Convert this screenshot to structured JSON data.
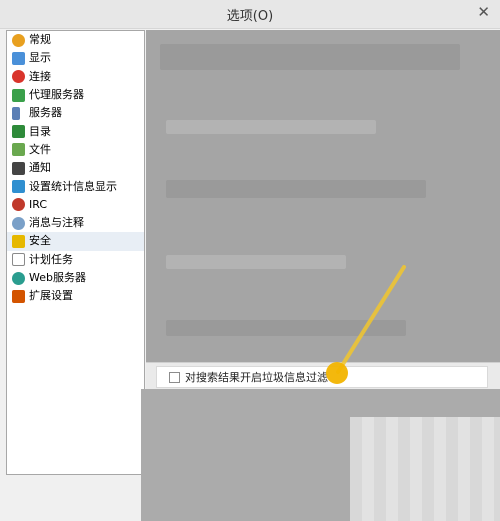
{
  "window": {
    "title": "选项(O)"
  },
  "sidebar": {
    "items": [
      {
        "label": "常规",
        "icon": "gear-icon",
        "color": "#e8a020"
      },
      {
        "label": "显示",
        "icon": "display-icon",
        "color": "#4a90d9"
      },
      {
        "label": "连接",
        "icon": "connection-icon",
        "color": "#d9342b"
      },
      {
        "label": "代理服务器",
        "icon": "proxy-icon",
        "color": "#3aa04a"
      },
      {
        "label": "服务器",
        "icon": "server-icon",
        "color": "#5b7fb5"
      },
      {
        "label": "目录",
        "icon": "folder-icon",
        "color": "#2e8b3a"
      },
      {
        "label": "文件",
        "icon": "file-icon",
        "color": "#6aa84f"
      },
      {
        "label": "通知",
        "icon": "notification-icon",
        "color": "#444444"
      },
      {
        "label": "设置统计信息显示",
        "icon": "statistics-icon",
        "color": "#2f8fd0"
      },
      {
        "label": "IRC",
        "icon": "irc-icon",
        "color": "#c0392b"
      },
      {
        "label": "消息与注释",
        "icon": "message-icon",
        "color": "#7aa0c8"
      },
      {
        "label": "安全",
        "icon": "lock-icon",
        "color": "#e6b800"
      },
      {
        "label": "计划任务",
        "icon": "schedule-icon",
        "color": "#8a8a8a"
      },
      {
        "label": "Web服务器",
        "icon": "web-icon",
        "color": "#2a9d8f"
      },
      {
        "label": "扩展设置",
        "icon": "extension-icon",
        "color": "#d35400"
      }
    ],
    "selected_index": 11
  },
  "security": {
    "spam_filter_checkbox_label": "对搜索结果开启垃圾信息过滤",
    "spam_filter_checked": false
  },
  "annotation": {
    "pointer_color": "#f2c62e"
  }
}
